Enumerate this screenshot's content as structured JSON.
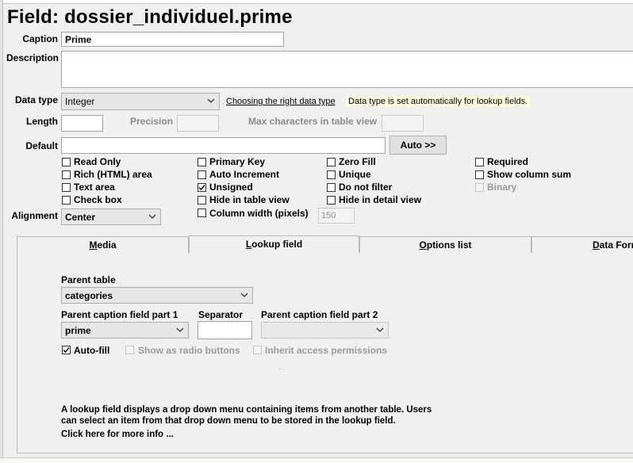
{
  "page": {
    "title": "Field: dossier_individuel.prime"
  },
  "caption": {
    "label": "Caption",
    "value": "Prime"
  },
  "description": {
    "label": "Description",
    "value": ""
  },
  "data_type": {
    "label": "Data type",
    "value": "Integer",
    "help_link": "Choosing the right data type",
    "note": "Data type is set automatically for lookup fields."
  },
  "length": {
    "label": "Length",
    "value": ""
  },
  "precision": {
    "label": "Precision",
    "value": ""
  },
  "max_chars": {
    "label": "Max characters in table view",
    "value": ""
  },
  "default": {
    "label": "Default",
    "value": "",
    "auto_button": "Auto >>"
  },
  "checkboxes": {
    "read_only": {
      "label": "Read Only",
      "checked": false
    },
    "rich_html": {
      "label": "Rich (HTML) area",
      "checked": false
    },
    "text_area": {
      "label": "Text area",
      "checked": false
    },
    "check_box": {
      "label": "Check box",
      "checked": false
    },
    "primary_key": {
      "label": "Primary Key",
      "checked": false
    },
    "auto_increment": {
      "label": "Auto Increment",
      "checked": false
    },
    "unsigned": {
      "label": "Unsigned",
      "checked": true
    },
    "hide_table_view": {
      "label": "Hide in table view",
      "checked": false
    },
    "column_width": {
      "label": "Column width (pixels)",
      "checked": false
    },
    "zero_fill": {
      "label": "Zero Fill",
      "checked": false
    },
    "unique": {
      "label": "Unique",
      "checked": false
    },
    "do_not_filter": {
      "label": "Do not filter",
      "checked": false
    },
    "hide_detail_view": {
      "label": "Hide in detail view",
      "checked": false
    },
    "required": {
      "label": "Required",
      "checked": false
    },
    "show_column_sum": {
      "label": "Show column sum",
      "checked": false
    },
    "binary": {
      "label": "Binary",
      "checked": false,
      "disabled": true
    }
  },
  "column_width_value": "150",
  "alignment": {
    "label": "Alignment",
    "value": "Center"
  },
  "tabs": [
    {
      "label": "Media",
      "mnemonic": "M",
      "rest": "edia",
      "active": false
    },
    {
      "label": "Lookup field",
      "mnemonic": "L",
      "rest": "ookup field",
      "active": true
    },
    {
      "label": "Options list",
      "mnemonic": "O",
      "rest": "ptions list",
      "active": false
    },
    {
      "label": "Data Format",
      "mnemonic": "D",
      "rest": "ata Forma",
      "active": false
    }
  ],
  "lookup": {
    "parent_table_label": "Parent table",
    "parent_table_value": "categories",
    "caption_part1_label": "Parent caption field part 1",
    "caption_part1_value": "prime",
    "separator_label": "Separator",
    "separator_value": "",
    "caption_part2_label": "Parent caption field part 2",
    "caption_part2_value": "",
    "auto_fill": {
      "label": "Auto-fill",
      "checked": true
    },
    "show_as_radio": {
      "label": "Show as radio buttons",
      "checked": false,
      "disabled": true
    },
    "inherit_permissions": {
      "label": "Inherit access permissions",
      "checked": false,
      "disabled": true
    },
    "info_line1": "A lookup field displays a drop down menu containing items from another table. Users",
    "info_line2": "can select an item from that drop down menu to be stored in the lookup field.",
    "more_info": "Click here for more info ..."
  }
}
